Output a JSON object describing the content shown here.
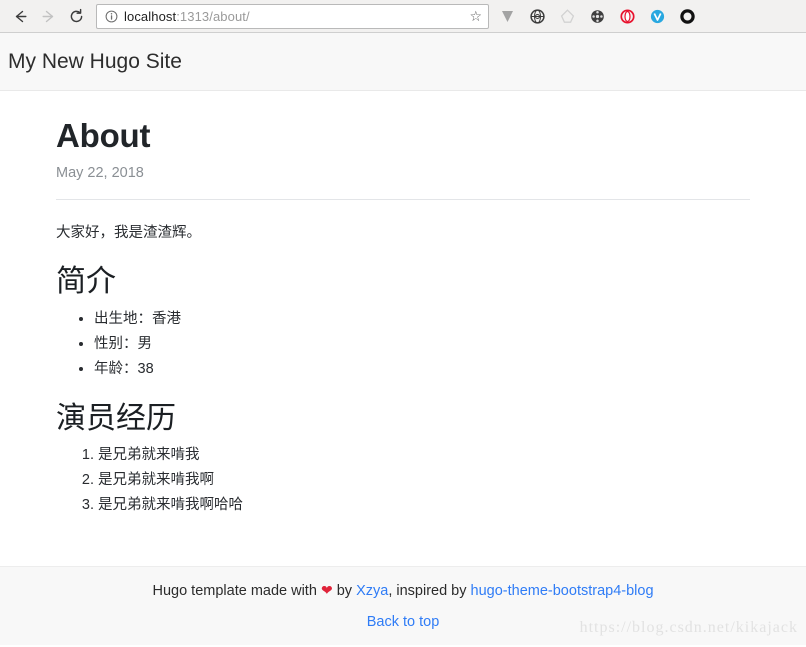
{
  "browser": {
    "back_icon": "back-arrow-icon",
    "forward_icon": "forward-arrow-icon",
    "reload_icon": "reload-icon",
    "info_icon": "info-circle-icon",
    "url_host": "localhost",
    "url_rest": ":1313/about/",
    "url_full": "localhost:1313/about/",
    "star_icon": "☆",
    "extensions": [
      {
        "name": "vimium-v-icon",
        "glyph": "V",
        "color": "#9b9b9b"
      },
      {
        "name": "globe-extension-icon",
        "glyph": "◉",
        "color": "#444444"
      },
      {
        "name": "outline-diamond-icon",
        "glyph": "◈",
        "color": "#d5d5d5"
      },
      {
        "name": "film-reel-icon",
        "glyph": "◍",
        "color": "#3a3a3a"
      },
      {
        "name": "opera-o-icon",
        "glyph": "O",
        "color": "#e8112d"
      },
      {
        "name": "blue-check-circle-icon",
        "glyph": "V",
        "color": "#29a8e0"
      },
      {
        "name": "black-ring-icon",
        "glyph": "O",
        "color": "#111111"
      }
    ]
  },
  "site": {
    "title": "My New Hugo Site"
  },
  "post": {
    "title": "About",
    "date": "May 22, 2018",
    "intro": "大家好，我是渣渣辉。",
    "sections": [
      {
        "heading": "简介",
        "list_type": "bullet",
        "items": [
          "出生地：香港",
          "性别：男",
          "年龄：38"
        ]
      },
      {
        "heading": "演员经历",
        "list_type": "ordered",
        "items": [
          "是兄弟就来啃我",
          "是兄弟就来啃我啊",
          "是兄弟就来啃我啊哈哈"
        ]
      }
    ]
  },
  "footer": {
    "prefix": "Hugo template made with",
    "heart": "❤",
    "by": "by",
    "author_link": "Xzya",
    "middle": ", inspired by",
    "theme_link": "hugo-theme-bootstrap4-blog",
    "back_to_top": "Back to top",
    "watermark": "https://blog.csdn.net/kikajack",
    "link_color": "#2f7cf6",
    "heart_color": "#e0243a"
  }
}
